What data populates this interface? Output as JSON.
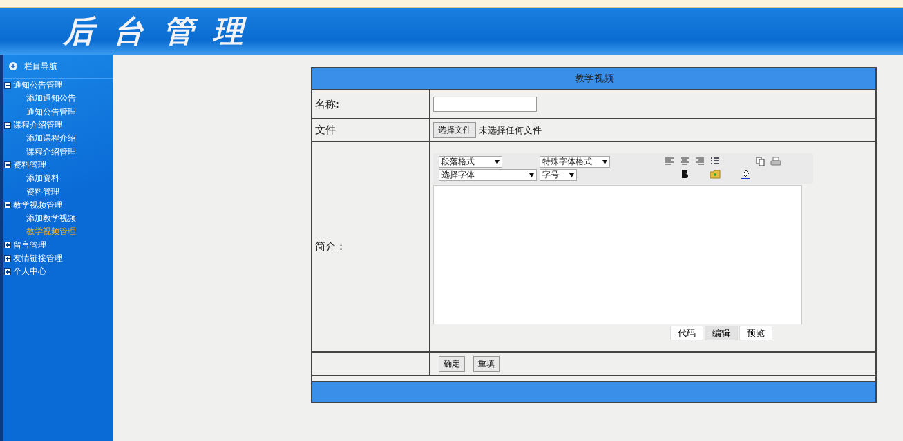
{
  "header": {
    "title": "后台管理"
  },
  "sidebar": {
    "heading": "栏目导航",
    "groups": [
      {
        "label": "通知公告管理",
        "expanded": true,
        "children": [
          {
            "label": "添加通知公告",
            "selected": false
          },
          {
            "label": "通知公告管理",
            "selected": false
          }
        ]
      },
      {
        "label": "课程介绍管理",
        "expanded": true,
        "children": [
          {
            "label": "添加课程介绍",
            "selected": false
          },
          {
            "label": "课程介绍管理",
            "selected": false
          }
        ]
      },
      {
        "label": "资料管理",
        "expanded": true,
        "children": [
          {
            "label": "添加资料",
            "selected": false
          },
          {
            "label": "资料管理",
            "selected": false
          }
        ]
      },
      {
        "label": "教学视频管理",
        "expanded": true,
        "children": [
          {
            "label": "添加教学视频",
            "selected": false
          },
          {
            "label": "教学视频管理",
            "selected": true
          }
        ]
      },
      {
        "label": "留言管理",
        "expanded": false
      },
      {
        "label": "友情链接管理",
        "expanded": false
      },
      {
        "label": "个人中心",
        "expanded": false
      }
    ]
  },
  "form": {
    "title": "教学视频",
    "name_label": "名称:",
    "file_label": "文件",
    "file_button": "选择文件",
    "file_status": "未选择任何文件",
    "intro_label": "简介：",
    "editor": {
      "selects": [
        [
          "段落格式",
          "特殊字体格式"
        ],
        [
          "选择字体",
          "字号"
        ]
      ],
      "modes": [
        {
          "label": "代码",
          "selected": false
        },
        {
          "label": "编辑",
          "selected": true
        },
        {
          "label": "预览",
          "selected": false
        }
      ]
    },
    "buttons": [
      "确定",
      "重填"
    ]
  }
}
